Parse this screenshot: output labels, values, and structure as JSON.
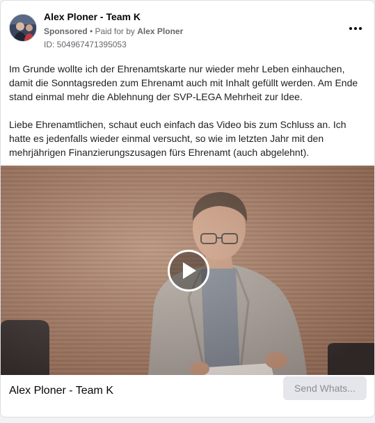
{
  "post": {
    "page_name": "Alex Ploner - Team K",
    "sponsored_label": "Sponsored",
    "separator": " • ",
    "paid_for_label": "Paid for by ",
    "paid_for_name": "Alex Ploner",
    "ad_id": "ID: 504967471395053",
    "more_icon": "more-horizontal-icon",
    "body_paragraphs": [
      "Im Grunde wollte ich der Ehrenamtskarte nur wieder mehr Leben einhauchen, damit die Sonntagsreden zum Ehrenamt auch mit Inhalt gefüllt werden. Am Ende stand einmal mehr die Ablehnung der SVP-LEGA Mehrheit zur Idee.",
      "Liebe Ehrenamtlichen, schaut euch einfach das Video bis zum Schluss an. Ich hatte es jedenfalls wieder einmal versucht, so wie im letzten Jahr mit den mehrjährigen Finanzierungszusagen fürs Ehrenamt (auch abgelehnt)."
    ]
  },
  "video": {
    "play_icon": "play-icon"
  },
  "footer": {
    "title": "Alex Ploner - Team K",
    "cta_label": "Send Whats..."
  },
  "colors": {
    "text_primary": "#050505",
    "text_secondary": "#65676b",
    "cta_background": "#e4e6eb",
    "cta_text": "#8a8d91"
  }
}
